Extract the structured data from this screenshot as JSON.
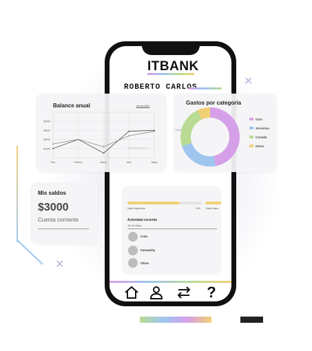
{
  "app": {
    "logo": "ITBANK",
    "username": "ROBERTO CARLOS"
  },
  "balance_card": {
    "title": "Balance anual",
    "filter_label": "ahorro/año",
    "watermark": "Mis ingresos"
  },
  "chart_data": {
    "type": "line",
    "title": "Balance anual",
    "categories": [
      "Ene",
      "Febrero",
      "Marzo",
      "Abril",
      "Mayo"
    ],
    "ytick_labels": [
      "$4000",
      "$3000",
      "$2000",
      "$1000"
    ],
    "series": [
      {
        "values": [
          1000,
          2000,
          500,
          2900,
          3000
        ]
      },
      {
        "values": [
          1500,
          2000,
          1200,
          2400,
          2900
        ]
      }
    ],
    "ylim": [
      0,
      5000
    ],
    "grid": true
  },
  "expenses_card": {
    "title": "Gastos por categoría",
    "side_label": "Gasto",
    "chart_data": {
      "type": "pie",
      "categories": [
        "Ocio",
        "Servicios",
        "Comida",
        "Otros"
      ],
      "values": [
        47,
        23,
        23,
        7
      ],
      "colors": [
        "#d6a0e8",
        "#9fc6ef",
        "#b9db93",
        "#f1cf73"
      ]
    }
  },
  "balance_mini": {
    "title": "Mis saldos",
    "amount": "$3000",
    "account_type": "Cuenta corriente"
  },
  "activity": {
    "available_label": "Saldo disponible",
    "available_percent": "20%",
    "available_fill": 0.7,
    "second_label": "Saldo dispo",
    "title": "Actividad reciente",
    "date": "15 de Mayo",
    "items": [
      "Coto",
      "Farmacity",
      "Otros"
    ]
  },
  "nav": {
    "icons": [
      "home-icon",
      "user-icon",
      "transfer-icon",
      "help-icon"
    ],
    "help_glyph": "?"
  },
  "colors": {
    "ocio": "#d6a0e8",
    "servicios": "#9fc6ef",
    "comida": "#b9db93",
    "otros": "#f1cf73"
  }
}
